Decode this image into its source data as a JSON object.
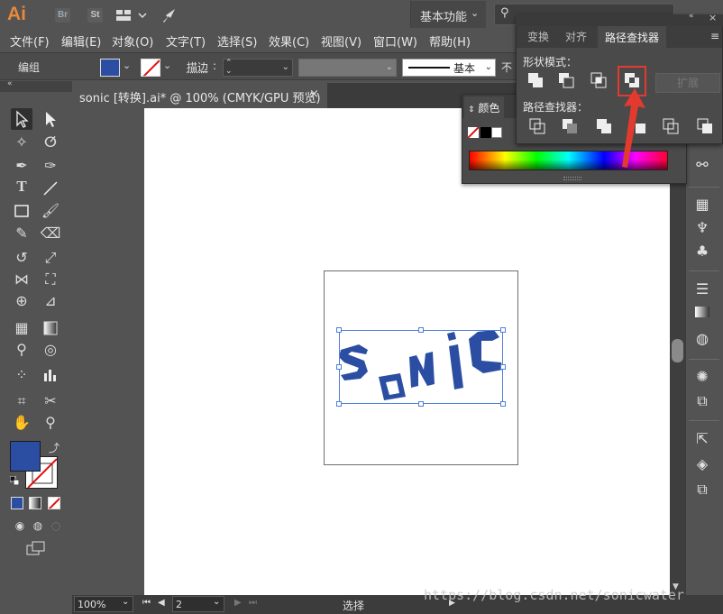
{
  "app": {
    "logo": "Ai",
    "bridge_label": "Br",
    "stock_label": "St",
    "workspace": "基本功能"
  },
  "menu": {
    "items": [
      "文件(F)",
      "编辑(E)",
      "对象(O)",
      "文字(T)",
      "选择(S)",
      "效果(C)",
      "视图(V)",
      "窗口(W)",
      "帮助(H)"
    ]
  },
  "control": {
    "selection_type": "编组",
    "stroke_label": "描边",
    "stroke_profile": "基本",
    "opacity_label": "不",
    "fill_color": "#2b4ea3"
  },
  "document": {
    "tab_title": "sonic [转换].ai* @ 100% (CMYK/GPU 预览)",
    "close_glyph": "×",
    "artwork_text": "SoNiC",
    "artwork_color": "#2b4ea3"
  },
  "color_panel": {
    "title": "颜色"
  },
  "pathfinder_panel": {
    "tabs": [
      "变换",
      "对齐",
      "路径查找器"
    ],
    "active_tab": "路径查找器",
    "shape_modes_label": "形状模式：",
    "pathfinders_label": "路径查找器：",
    "expand_label": "扩展",
    "highlighted_button": "exclude-overlapping",
    "highlight_color": "#e23a2e"
  },
  "status": {
    "zoom": "100%",
    "page": "2",
    "tool_status": "选择",
    "watermark": "https://blog.csdn.net/sonicwater"
  }
}
